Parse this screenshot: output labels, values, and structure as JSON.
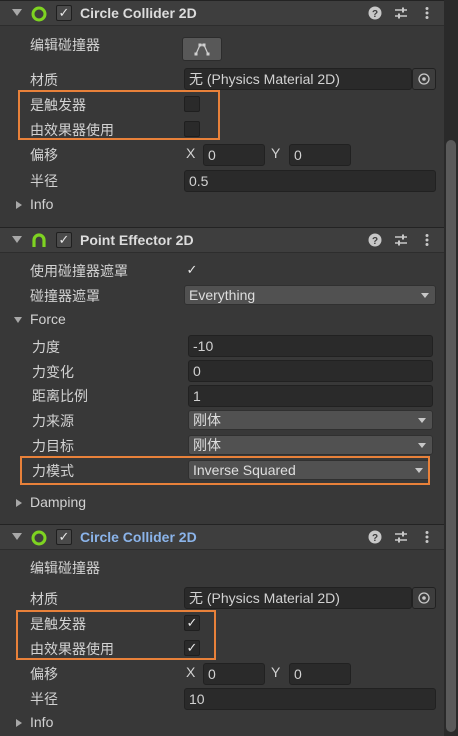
{
  "comp1": {
    "title": "Circle Collider 2D",
    "edit_collider": "编辑碰撞器",
    "material_label": "材质",
    "material_value": "无 (Physics Material 2D)",
    "is_trigger_label": "是触发器",
    "is_trigger": false,
    "used_by_effector_label": "由效果器使用",
    "used_by_effector": false,
    "offset_label": "偏移",
    "offset_x_label": "X",
    "offset_x": "0",
    "offset_y_label": "Y",
    "offset_y": "0",
    "radius_label": "半径",
    "radius": "0.5",
    "info_label": "Info"
  },
  "comp2": {
    "title": "Point Effector 2D",
    "use_collider_mask_label": "使用碰撞器遮罩",
    "use_collider_mask": true,
    "collider_mask_label": "碰撞器遮罩",
    "collider_mask_value": "Everything",
    "force_label": "Force",
    "force_magnitude_label": "力度",
    "force_magnitude": "-10",
    "force_variation_label": "力变化",
    "force_variation": "0",
    "distance_scale_label": "距离比例",
    "distance_scale": "1",
    "force_source_label": "力来源",
    "force_source": "刚体",
    "force_target_label": "力目标",
    "force_target": "刚体",
    "force_mode_label": "力模式",
    "force_mode": "Inverse Squared",
    "damping_label": "Damping"
  },
  "comp3": {
    "title": "Circle Collider 2D",
    "edit_collider": "编辑碰撞器",
    "material_label": "材质",
    "material_value": "无 (Physics Material 2D)",
    "is_trigger_label": "是触发器",
    "is_trigger": true,
    "used_by_effector_label": "由效果器使用",
    "used_by_effector": true,
    "offset_label": "偏移",
    "offset_x_label": "X",
    "offset_x": "0",
    "offset_y_label": "Y",
    "offset_y": "0",
    "radius_label": "半径",
    "radius": "10",
    "info_label": "Info"
  },
  "icons": {
    "circle_collider": "circle-collider-icon",
    "point_effector": "magnet-icon",
    "help": "help-icon",
    "preset": "preset-icon",
    "more": "kebab-menu-icon"
  },
  "colors": {
    "highlight": "#e8813a",
    "collider_icon": "#7ed321",
    "effector_icon": "#7ed321",
    "selected_title": "#8bb4ea"
  }
}
